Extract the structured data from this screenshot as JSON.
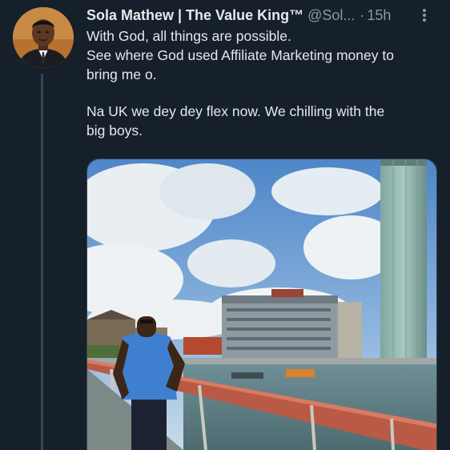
{
  "tweet": {
    "display_name": "Sola Mathew | The Value King™",
    "handle": "@Sol...",
    "separator": "·",
    "time": "15h",
    "lines_1": [
      "With God, all things are possible.",
      "See where God used Affiliate Marketing money to",
      "bring me o."
    ],
    "lines_2": [
      "Na UK we dey dey flex now. We chilling with the",
      "big boys."
    ]
  },
  "icons": {
    "more": "more-vertical-icon"
  },
  "colors": {
    "background": "#15202b",
    "text": "#e7e9ea",
    "secondary": "#8b98a5",
    "thread_line": "#38444d"
  }
}
